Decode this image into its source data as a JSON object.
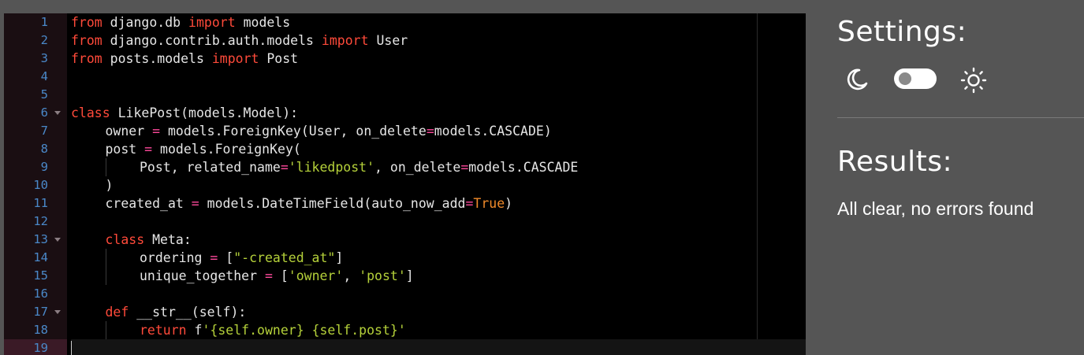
{
  "editor": {
    "lines": [
      {
        "number": "1",
        "fold": false,
        "indent": 0,
        "tokens": [
          [
            "kw",
            "from"
          ],
          [
            "id",
            " django.db "
          ],
          [
            "kw",
            "import"
          ],
          [
            "id",
            " models"
          ]
        ]
      },
      {
        "number": "2",
        "fold": false,
        "indent": 0,
        "tokens": [
          [
            "kw",
            "from"
          ],
          [
            "id",
            " django.contrib.auth.models "
          ],
          [
            "kw",
            "import"
          ],
          [
            "id",
            " User"
          ]
        ]
      },
      {
        "number": "3",
        "fold": false,
        "indent": 0,
        "tokens": [
          [
            "kw",
            "from"
          ],
          [
            "id",
            " posts.models "
          ],
          [
            "kw",
            "import"
          ],
          [
            "id",
            " Post"
          ]
        ]
      },
      {
        "number": "4",
        "fold": false,
        "indent": 0,
        "tokens": []
      },
      {
        "number": "5",
        "fold": false,
        "indent": 0,
        "tokens": []
      },
      {
        "number": "6",
        "fold": true,
        "indent": 0,
        "tokens": [
          [
            "kw",
            "class"
          ],
          [
            "id",
            " LikePost(models.Model):"
          ]
        ]
      },
      {
        "number": "7",
        "fold": false,
        "indent": 1,
        "tokens": [
          [
            "id",
            "owner "
          ],
          [
            "op",
            "="
          ],
          [
            "id",
            " models.ForeignKey(User, on_delete"
          ],
          [
            "op",
            "="
          ],
          [
            "id",
            "models.CASCADE)"
          ]
        ]
      },
      {
        "number": "8",
        "fold": false,
        "indent": 1,
        "tokens": [
          [
            "id",
            "post "
          ],
          [
            "op",
            "="
          ],
          [
            "id",
            " models.ForeignKey("
          ]
        ]
      },
      {
        "number": "9",
        "fold": false,
        "indent": 2,
        "tokens": [
          [
            "id",
            "Post, related_name"
          ],
          [
            "op",
            "="
          ],
          [
            "str",
            "'likedpost'"
          ],
          [
            "id",
            ", on_delete"
          ],
          [
            "op",
            "="
          ],
          [
            "id",
            "models.CASCADE"
          ]
        ]
      },
      {
        "number": "10",
        "fold": false,
        "indent": 1,
        "tokens": [
          [
            "id",
            ")"
          ]
        ]
      },
      {
        "number": "11",
        "fold": false,
        "indent": 1,
        "tokens": [
          [
            "id",
            "created_at "
          ],
          [
            "op",
            "="
          ],
          [
            "id",
            " models.DateTimeField(auto_now_add"
          ],
          [
            "op",
            "="
          ],
          [
            "const",
            "True"
          ],
          [
            "id",
            ")"
          ]
        ]
      },
      {
        "number": "12",
        "fold": false,
        "indent": 0,
        "tokens": []
      },
      {
        "number": "13",
        "fold": true,
        "indent": 1,
        "tokens": [
          [
            "kw",
            "class"
          ],
          [
            "id",
            " Meta:"
          ]
        ]
      },
      {
        "number": "14",
        "fold": false,
        "indent": 2,
        "tokens": [
          [
            "id",
            "ordering "
          ],
          [
            "op",
            "="
          ],
          [
            "id",
            " ["
          ],
          [
            "str",
            "\"-created_at\""
          ],
          [
            "id",
            "]"
          ]
        ]
      },
      {
        "number": "15",
        "fold": false,
        "indent": 2,
        "tokens": [
          [
            "id",
            "unique_together "
          ],
          [
            "op",
            "="
          ],
          [
            "id",
            " ["
          ],
          [
            "str",
            "'owner'"
          ],
          [
            "id",
            ", "
          ],
          [
            "str",
            "'post'"
          ],
          [
            "id",
            "]"
          ]
        ]
      },
      {
        "number": "16",
        "fold": false,
        "indent": 0,
        "tokens": []
      },
      {
        "number": "17",
        "fold": true,
        "indent": 1,
        "tokens": [
          [
            "kw",
            "def"
          ],
          [
            "id",
            " __str__(self):"
          ]
        ]
      },
      {
        "number": "18",
        "fold": false,
        "indent": 2,
        "tokens": [
          [
            "kw",
            "return"
          ],
          [
            "id",
            " f"
          ],
          [
            "str",
            "'{self.owner} {self.post}'"
          ]
        ]
      },
      {
        "number": "19",
        "fold": false,
        "indent": 0,
        "tokens": [],
        "active": true
      }
    ]
  },
  "panel": {
    "settings_title": "Settings:",
    "theme": {
      "left_icon": "moon-icon",
      "right_icon": "sun-icon",
      "toggle_state": "off"
    },
    "results_title": "Results:",
    "results_message": "All clear, no errors found"
  },
  "colors": {
    "keyword": "#ff4a3a",
    "operator": "#ff4a9c",
    "string": "#b5d13a",
    "constant": "#f08a2a",
    "line_number": "#4a88c8",
    "editor_bg": "#000000",
    "panel_bg": "#555555"
  }
}
